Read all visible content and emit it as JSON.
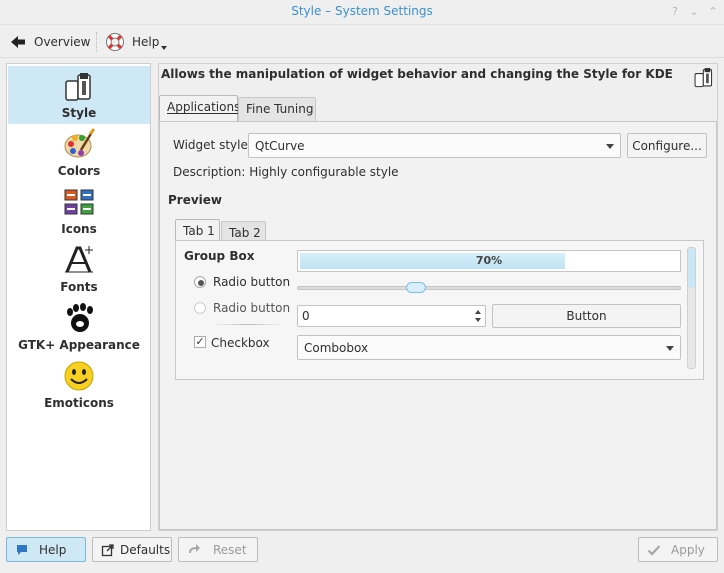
{
  "window": {
    "title": "Style – System Settings"
  },
  "toolbar": {
    "overview_label": "Overview",
    "help_label": "Help"
  },
  "sidebar": {
    "items": [
      {
        "label": "Style",
        "icon": "style-icon",
        "selected": true
      },
      {
        "label": "Colors",
        "icon": "colors-icon"
      },
      {
        "label": "Icons",
        "icon": "icons-icon"
      },
      {
        "label": "Fonts",
        "icon": "fonts-icon"
      },
      {
        "label": "GTK+ Appearance",
        "icon": "gnome-foot-icon"
      },
      {
        "label": "Emoticons",
        "icon": "emoticon-icon"
      }
    ]
  },
  "main": {
    "description": "Allows the manipulation of widget behavior and changing the Style for KDE",
    "tabs": [
      {
        "label": "Applications",
        "active": true
      },
      {
        "label": "Fine Tuning"
      }
    ],
    "widget_style_label": "Widget style:",
    "widget_style_value": "QtCurve",
    "configure_label": "Configure...",
    "description_line": "Description: Highly configurable style",
    "preview_label": "Preview",
    "preview": {
      "tabs": [
        {
          "label": "Tab 1",
          "active": true
        },
        {
          "label": "Tab 2"
        }
      ],
      "group_box_label": "Group Box",
      "radio1_label": "Radio button",
      "radio2_label": "Radio button",
      "checkbox_label": "Checkbox",
      "progress_text": "70%",
      "progress_fraction": 0.7,
      "spin_value": "0",
      "button_label": "Button",
      "combobox_label": "Combobox"
    }
  },
  "footer": {
    "help_label": "Help",
    "defaults_label": "Defaults",
    "reset_label": "Reset",
    "apply_label": "Apply"
  },
  "colors": {
    "accent": "#3d8fd1",
    "selection": "#cfe8f6"
  }
}
